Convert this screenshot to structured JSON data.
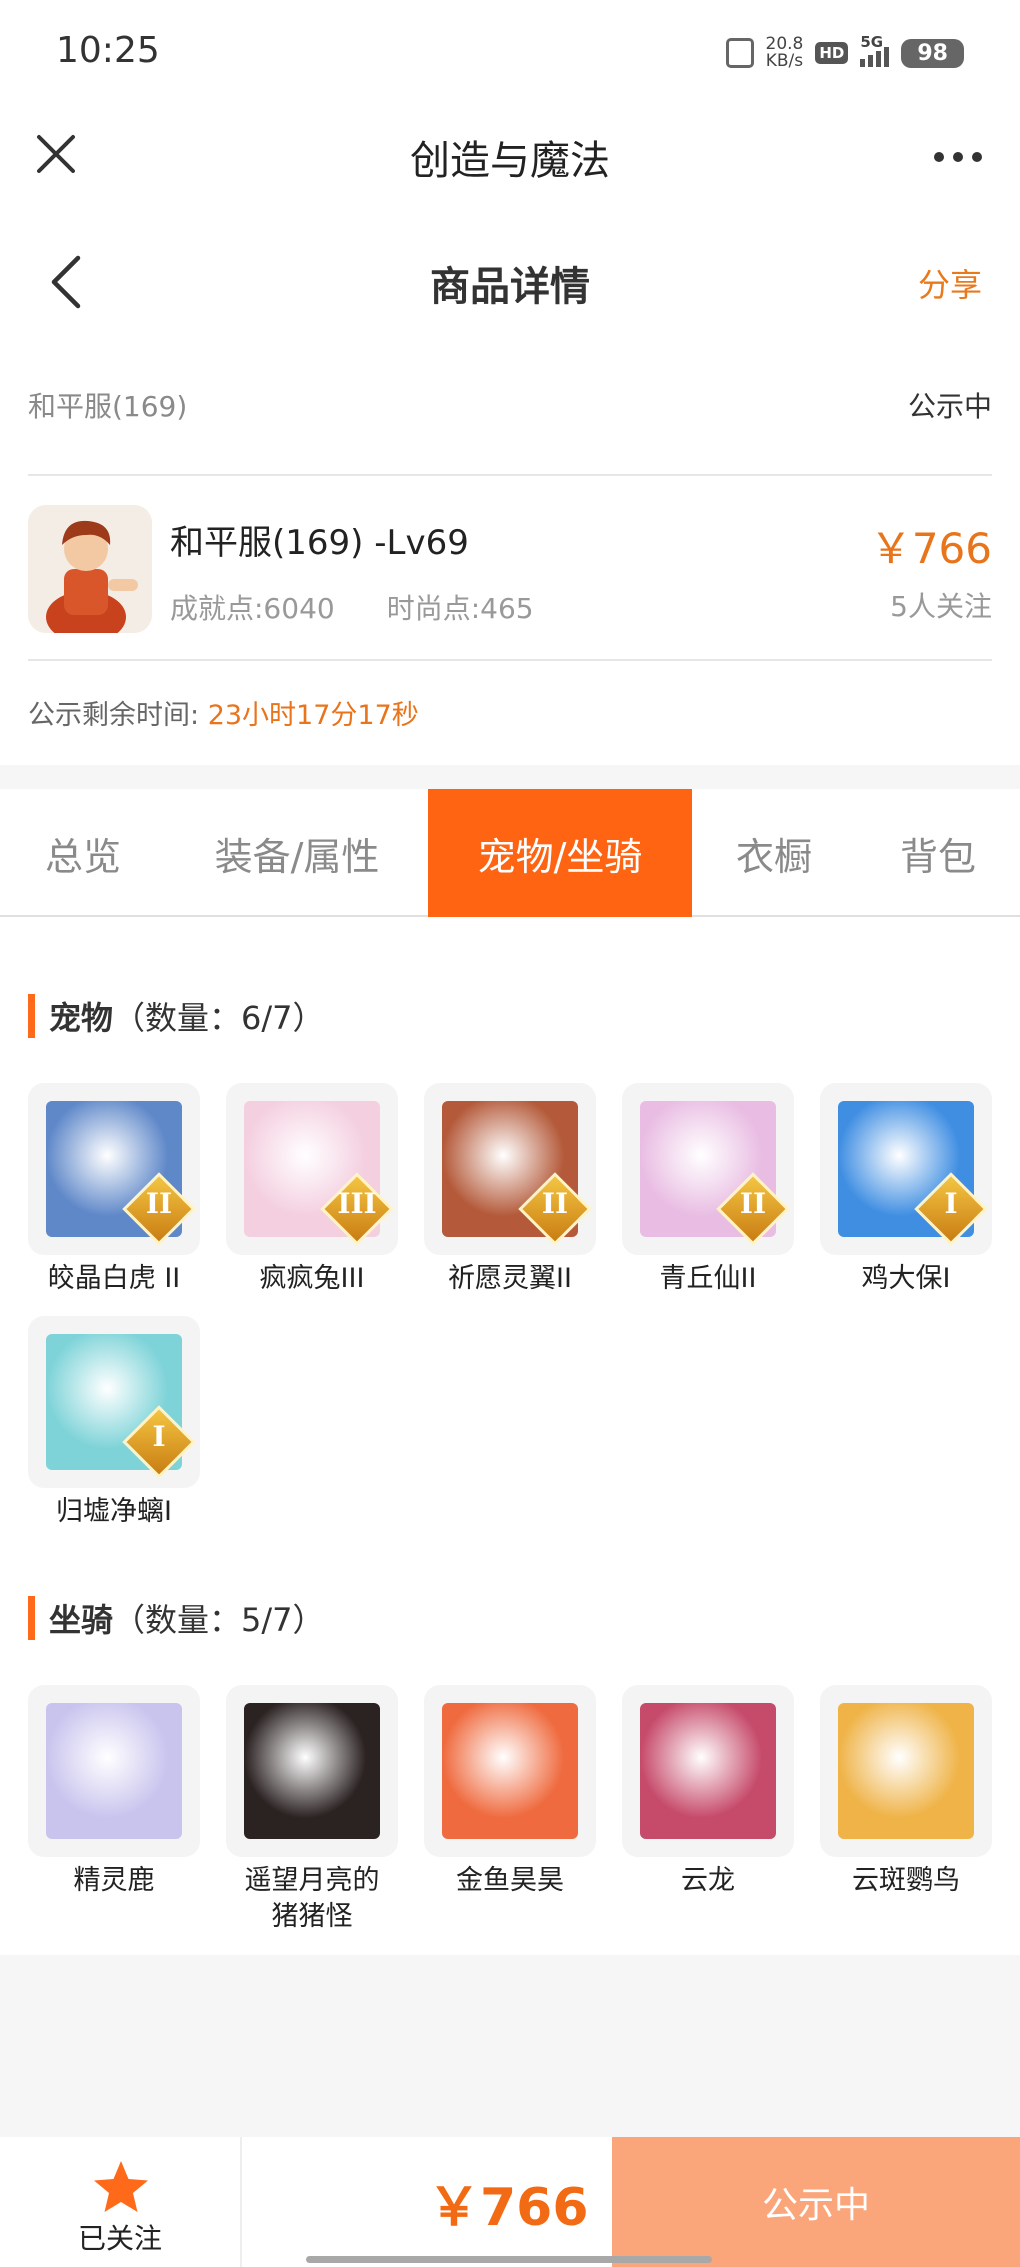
{
  "status_bar": {
    "time": "10:25",
    "net_speed_value": "20.8",
    "net_speed_unit": "KB/s",
    "hd_label": "HD",
    "network_label": "5G",
    "battery": "98"
  },
  "app_header": {
    "title": "创造与魔法",
    "close_icon": "close-icon",
    "more_icon": "more-icon"
  },
  "nav": {
    "title": "商品详情",
    "share_label": "分享",
    "back_icon": "back-icon"
  },
  "listing": {
    "server": "和平服(169)",
    "status": "公示中",
    "name": "和平服(169) -Lv69",
    "achievement": "成就点:6040",
    "fashion": "时尚点:465",
    "price": "￥766",
    "followers": "5人关注",
    "remaining_label": "公示剩余时间:",
    "remaining_value": "23小时17分17秒"
  },
  "tabs": [
    {
      "label": "总览",
      "active": false
    },
    {
      "label": "装备/属性",
      "active": false
    },
    {
      "label": "宠物/坐骑",
      "active": true
    },
    {
      "label": "衣橱",
      "active": false
    },
    {
      "label": "背包",
      "active": false
    }
  ],
  "pets": {
    "title": "宠物",
    "count": "（数量：6/7）",
    "items": [
      {
        "name": "皎晶白虎 II",
        "grade": "II",
        "color": "#5f88c9"
      },
      {
        "name": "疯疯兔III",
        "grade": "III",
        "color": "#f4cfe0"
      },
      {
        "name": "祈愿灵翼II",
        "grade": "II",
        "color": "#b45a3a"
      },
      {
        "name": "青丘仙II",
        "grade": "II",
        "color": "#e9bde3"
      },
      {
        "name": "鸡大保I",
        "grade": "I",
        "color": "#3f8ee2"
      },
      {
        "name": "归墟净螭I",
        "grade": "I",
        "color": "#7dd3d8"
      }
    ]
  },
  "mounts": {
    "title": "坐骑",
    "count": "（数量：5/7）",
    "items": [
      {
        "name": "精灵鹿",
        "color": "#c9c4ee"
      },
      {
        "name": "遥望月亮的猪猪怪",
        "color": "#2b2222"
      },
      {
        "name": "金鱼昊昊",
        "color": "#ef6a3e"
      },
      {
        "name": "云龙",
        "color": "#c64a6a"
      },
      {
        "name": "云斑鹦鸟",
        "color": "#efb347"
      }
    ]
  },
  "bottom_bar": {
    "follow_label": "已关注",
    "price": "￥766",
    "action_label": "公示中"
  },
  "colors": {
    "accent": "#ff6412",
    "price": "#e8741c",
    "action_button": "#fba57a"
  }
}
